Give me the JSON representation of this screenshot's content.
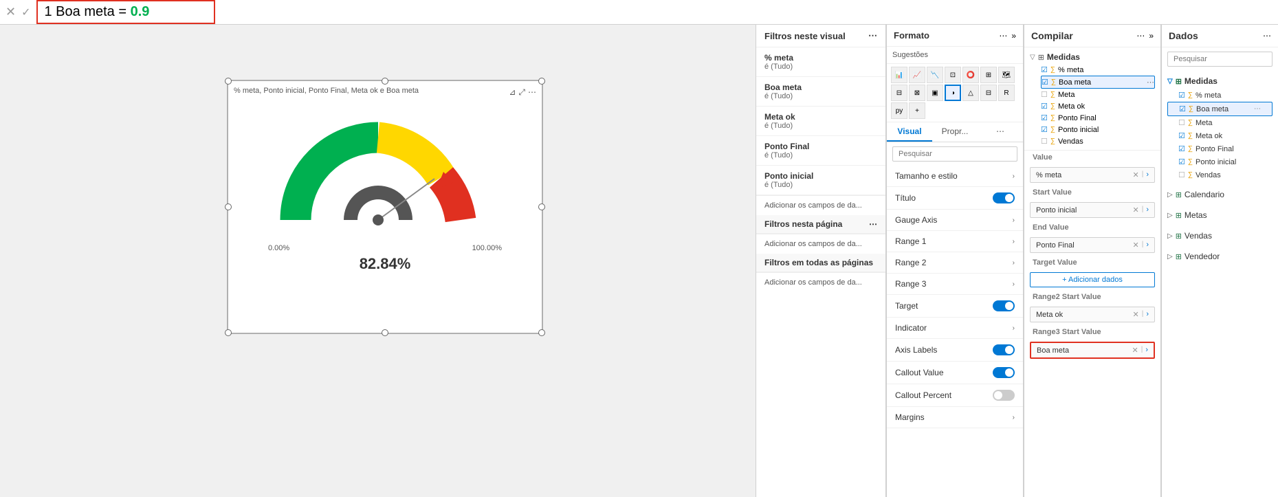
{
  "topbar": {
    "close_label": "✕",
    "check_label": "✓",
    "formula": "1 Boa meta = 0.9"
  },
  "gauge": {
    "header": "% meta, Ponto inicial, Ponto Final, Meta ok e Boa meta",
    "value": "82.84%",
    "label_start": "0.00%",
    "label_end": "100.00%",
    "filter_icon": "⊞",
    "more_icon": "⋯"
  },
  "filter_panel": {
    "title": "Filtros neste visual",
    "more": "⋯",
    "items": [
      {
        "name": "% meta",
        "value": "é (Tudo)"
      },
      {
        "name": "Boa meta",
        "value": "é (Tudo)"
      },
      {
        "name": "Meta ok",
        "value": "é (Tudo)"
      },
      {
        "name": "Ponto Final",
        "value": "é (Tudo)"
      },
      {
        "name": "Ponto inicial",
        "value": "é (Tudo)"
      }
    ],
    "add_fields_label": "Adicionar os campos de da...",
    "page_filter_title": "Filtros nesta página",
    "page_filter_more": "⋯",
    "page_add_label": "Adicionar os campos de da...",
    "all_filter_title": "Filtros em todas as páginas",
    "all_add_label": "Adicionar os campos de da..."
  },
  "format_panel": {
    "title": "Formato",
    "more": "⋯",
    "expand": "»",
    "search_placeholder": "Pesquisar",
    "tabs": [
      {
        "label": "Visual",
        "active": true
      },
      {
        "label": "Propr...",
        "active": false
      },
      {
        "label": "⋯",
        "active": false
      }
    ],
    "suggestions_label": "Sugestões",
    "sections": [
      {
        "label": "Tamanho e estilo",
        "toggle": null
      },
      {
        "label": "Título",
        "toggle": "on"
      },
      {
        "label": "Gauge Axis",
        "toggle": null
      },
      {
        "label": "Range 1",
        "toggle": null
      },
      {
        "label": "Range 2",
        "toggle": null
      },
      {
        "label": "Range 3",
        "toggle": null
      },
      {
        "label": "Target",
        "toggle": "on"
      },
      {
        "label": "Indicator",
        "toggle": null
      },
      {
        "label": "Axis Labels",
        "toggle": "on"
      },
      {
        "label": "Callout Value",
        "toggle": "on"
      },
      {
        "label": "Callout Percent",
        "toggle": "off"
      },
      {
        "label": "Margins",
        "toggle": null
      }
    ]
  },
  "compile_panel": {
    "title": "Compilar",
    "more": "⋯",
    "expand": "»",
    "fields": [
      {
        "label": "Value",
        "value": "% meta",
        "has_x": true,
        "has_arrow": true
      },
      {
        "label": "Start Value",
        "value": "Ponto inicial",
        "has_x": true,
        "has_arrow": true
      },
      {
        "label": "End Value",
        "value": "Ponto Final",
        "has_x": true,
        "has_arrow": true
      },
      {
        "label": "Target Value",
        "add_data": true
      },
      {
        "label": "Range2 Start Value",
        "value": "Meta ok",
        "has_x": true,
        "has_arrow": true
      },
      {
        "label": "Range3 Start Value",
        "value": "Boa meta",
        "has_x": true,
        "has_arrow": true,
        "highlighted": true
      }
    ]
  },
  "data_panel": {
    "title": "Dados",
    "more": "⋯",
    "search_placeholder": "Pesquisar",
    "groups": [
      {
        "name": "Medidas",
        "expanded": true,
        "icon": "▽",
        "items": [
          {
            "name": "% meta",
            "checked": true,
            "type": "measure"
          },
          {
            "name": "Boa meta",
            "checked": true,
            "type": "measure",
            "selected": true
          },
          {
            "name": "Meta",
            "checked": false,
            "type": "measure"
          },
          {
            "name": "Meta ok",
            "checked": true,
            "type": "measure"
          },
          {
            "name": "Ponto Final",
            "checked": true,
            "type": "measure"
          },
          {
            "name": "Ponto inicial",
            "checked": true,
            "type": "measure"
          },
          {
            "name": "Vendas",
            "checked": false,
            "type": "measure"
          }
        ]
      },
      {
        "name": "Calendario",
        "expanded": false,
        "icon": "▷",
        "items": []
      },
      {
        "name": "Metas",
        "expanded": false,
        "icon": "▷",
        "items": []
      },
      {
        "name": "Vendas",
        "expanded": false,
        "icon": "▷",
        "items": []
      },
      {
        "name": "Vendedor",
        "expanded": false,
        "icon": "▷",
        "items": []
      }
    ]
  }
}
